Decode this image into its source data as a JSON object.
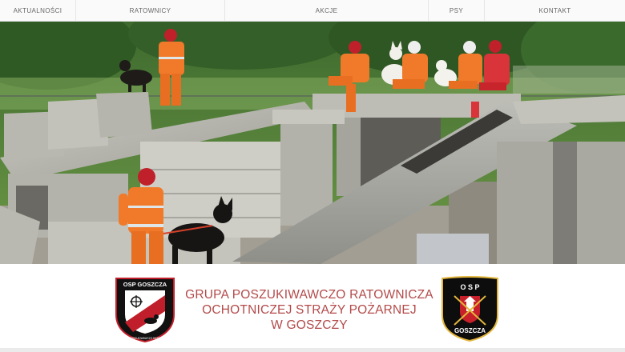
{
  "nav": {
    "items": [
      {
        "label": "AKTUALNOŚCI"
      },
      {
        "label": "RATOWNICY"
      },
      {
        "label": "AKCJE"
      },
      {
        "label": "PSY"
      },
      {
        "label": "KONTAKT"
      }
    ]
  },
  "hero": {
    "image": "rescue-team-photo"
  },
  "brand": {
    "title_lines": [
      "GRUPA POSZUKIWAWCZO RATOWNICZA",
      "OCHOTNICZEJ STRAŻY POŻARNEJ",
      "W GOSZCZY"
    ],
    "logo_left": {
      "top_text": "OSP GOSZCZA",
      "ring_text": "GRUPA POSZUKIWAWCZO RATOWNICZA"
    },
    "logo_right": {
      "top_text": "O S P",
      "bottom_text": "GOSZCZA"
    },
    "title_color": "#b34a4a"
  }
}
